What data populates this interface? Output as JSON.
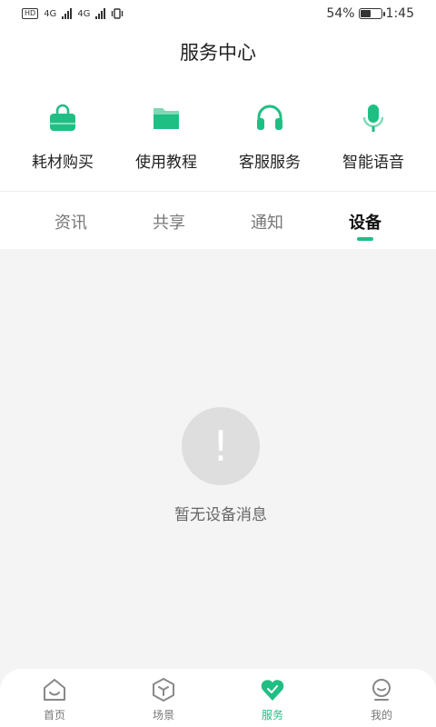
{
  "status_bar": {
    "left_badge": "HD",
    "network_1": "4G",
    "network_2": "4G",
    "battery_percent": "54%",
    "battery_level": 0.54,
    "time": "1:45"
  },
  "header": {
    "title": "服务中心"
  },
  "quick_actions": [
    {
      "label": "耗材购买",
      "icon": "shopping-bag-icon"
    },
    {
      "label": "使用教程",
      "icon": "folder-icon"
    },
    {
      "label": "客服服务",
      "icon": "headset-icon"
    },
    {
      "label": "智能语音",
      "icon": "microphone-icon"
    }
  ],
  "tabs": [
    {
      "label": "资讯",
      "active": false
    },
    {
      "label": "共享",
      "active": false
    },
    {
      "label": "通知",
      "active": false
    },
    {
      "label": "设备",
      "active": true
    }
  ],
  "empty_state": {
    "symbol": "!",
    "message": "暂无设备消息"
  },
  "bottom_nav": [
    {
      "label": "首页",
      "icon": "home-icon",
      "active": false
    },
    {
      "label": "场景",
      "icon": "cube-icon",
      "active": false
    },
    {
      "label": "服务",
      "icon": "heart-icon",
      "active": true
    },
    {
      "label": "我的",
      "icon": "profile-icon",
      "active": false
    }
  ],
  "colors": {
    "accent": "#1fbf84",
    "background": "#f4f4f4",
    "inactive_icon": "#888888"
  }
}
